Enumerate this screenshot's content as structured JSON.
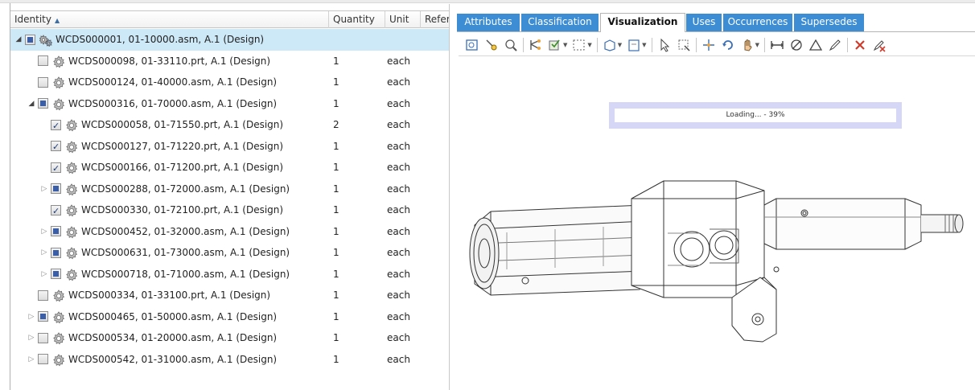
{
  "columns": {
    "identity": "Identity",
    "quantity": "Quantity",
    "unit": "Unit",
    "reference": "Refer"
  },
  "rows": [
    {
      "label": "WCDS000001, 01-10000.asm, A.1 (Design)",
      "qty": "",
      "unit": "",
      "level": 0,
      "toggle": "expanded",
      "check": "partial",
      "icon": "assembly-icon",
      "selected": true
    },
    {
      "label": "WCDS000098, 01-33110.prt, A.1 (Design)",
      "qty": "1",
      "unit": "each",
      "level": 1,
      "toggle": "none",
      "check": "off",
      "icon": "part-gear-icon"
    },
    {
      "label": "WCDS000124, 01-40000.asm, A.1 (Design)",
      "qty": "1",
      "unit": "each",
      "level": 1,
      "toggle": "none",
      "check": "off",
      "icon": "part-gear-icon"
    },
    {
      "label": "WCDS000316, 01-70000.asm, A.1 (Design)",
      "qty": "1",
      "unit": "each",
      "level": 1,
      "toggle": "expanded",
      "check": "partial",
      "icon": "part-gear-icon"
    },
    {
      "label": "WCDS000058, 01-71550.prt, A.1 (Design)",
      "qty": "2",
      "unit": "each",
      "level": 2,
      "toggle": "none",
      "check": "on",
      "icon": "part-gear-icon"
    },
    {
      "label": "WCDS000127, 01-71220.prt, A.1 (Design)",
      "qty": "1",
      "unit": "each",
      "level": 2,
      "toggle": "none",
      "check": "on",
      "icon": "part-gear-icon"
    },
    {
      "label": "WCDS000166, 01-71200.prt, A.1 (Design)",
      "qty": "1",
      "unit": "each",
      "level": 2,
      "toggle": "none",
      "check": "on",
      "icon": "part-gear-icon"
    },
    {
      "label": "WCDS000288, 01-72000.asm, A.1 (Design)",
      "qty": "1",
      "unit": "each",
      "level": 2,
      "toggle": "collapsed",
      "check": "partial",
      "icon": "part-gear-icon"
    },
    {
      "label": "WCDS000330, 01-72100.prt, A.1 (Design)",
      "qty": "1",
      "unit": "each",
      "level": 2,
      "toggle": "none",
      "check": "on",
      "icon": "part-gear-icon"
    },
    {
      "label": "WCDS000452, 01-32000.asm, A.1 (Design)",
      "qty": "1",
      "unit": "each",
      "level": 2,
      "toggle": "collapsed",
      "check": "partial",
      "icon": "part-gear-icon"
    },
    {
      "label": "WCDS000631, 01-73000.asm, A.1 (Design)",
      "qty": "1",
      "unit": "each",
      "level": 2,
      "toggle": "collapsed",
      "check": "partial",
      "icon": "part-gear-icon"
    },
    {
      "label": "WCDS000718, 01-71000.asm, A.1 (Design)",
      "qty": "1",
      "unit": "each",
      "level": 2,
      "toggle": "collapsed",
      "check": "partial",
      "icon": "part-gear-icon"
    },
    {
      "label": "WCDS000334, 01-33100.prt, A.1 (Design)",
      "qty": "1",
      "unit": "each",
      "level": 1,
      "toggle": "none",
      "check": "off",
      "icon": "part-gear-icon"
    },
    {
      "label": "WCDS000465, 01-50000.asm, A.1 (Design)",
      "qty": "1",
      "unit": "each",
      "level": 1,
      "toggle": "collapsed",
      "check": "partial",
      "icon": "part-gear-icon"
    },
    {
      "label": "WCDS000534, 01-20000.asm, A.1 (Design)",
      "qty": "1",
      "unit": "each",
      "level": 1,
      "toggle": "collapsed",
      "check": "off",
      "icon": "part-gear-icon"
    },
    {
      "label": "WCDS000542, 01-31000.asm, A.1 (Design)",
      "qty": "1",
      "unit": "each",
      "level": 1,
      "toggle": "collapsed",
      "check": "off",
      "icon": "part-gear-icon"
    }
  ],
  "tabs": [
    {
      "label": "Attributes",
      "active": false
    },
    {
      "label": "Classification",
      "active": false
    },
    {
      "label": "Visualization",
      "active": true
    },
    {
      "label": "Uses",
      "active": false
    },
    {
      "label": "Occurrences",
      "active": false
    },
    {
      "label": "Supersedes",
      "active": false
    }
  ],
  "toolbar_icons": [
    "zoom-window-icon",
    "zoom-selected-icon",
    "zoom-fit-icon",
    "structure-icon",
    "view-state-icon",
    "selection-box-icon",
    "display-mode-icon",
    "view-orientation-icon",
    "pointer-icon",
    "box-select-icon",
    "explode-icon",
    "rotate-icon",
    "pan-icon",
    "measure-distance-icon",
    "measure-diameter-icon",
    "measure-angle-icon",
    "annotate-icon",
    "delete-icon",
    "clear-markup-icon"
  ],
  "loading": {
    "text": "Loading... - 39%",
    "progress": 0.39
  },
  "colors": {
    "tab_blue": "#3c8dd4",
    "selected_row": "#cde8f6",
    "progress_bg": "#d6d6f7"
  }
}
